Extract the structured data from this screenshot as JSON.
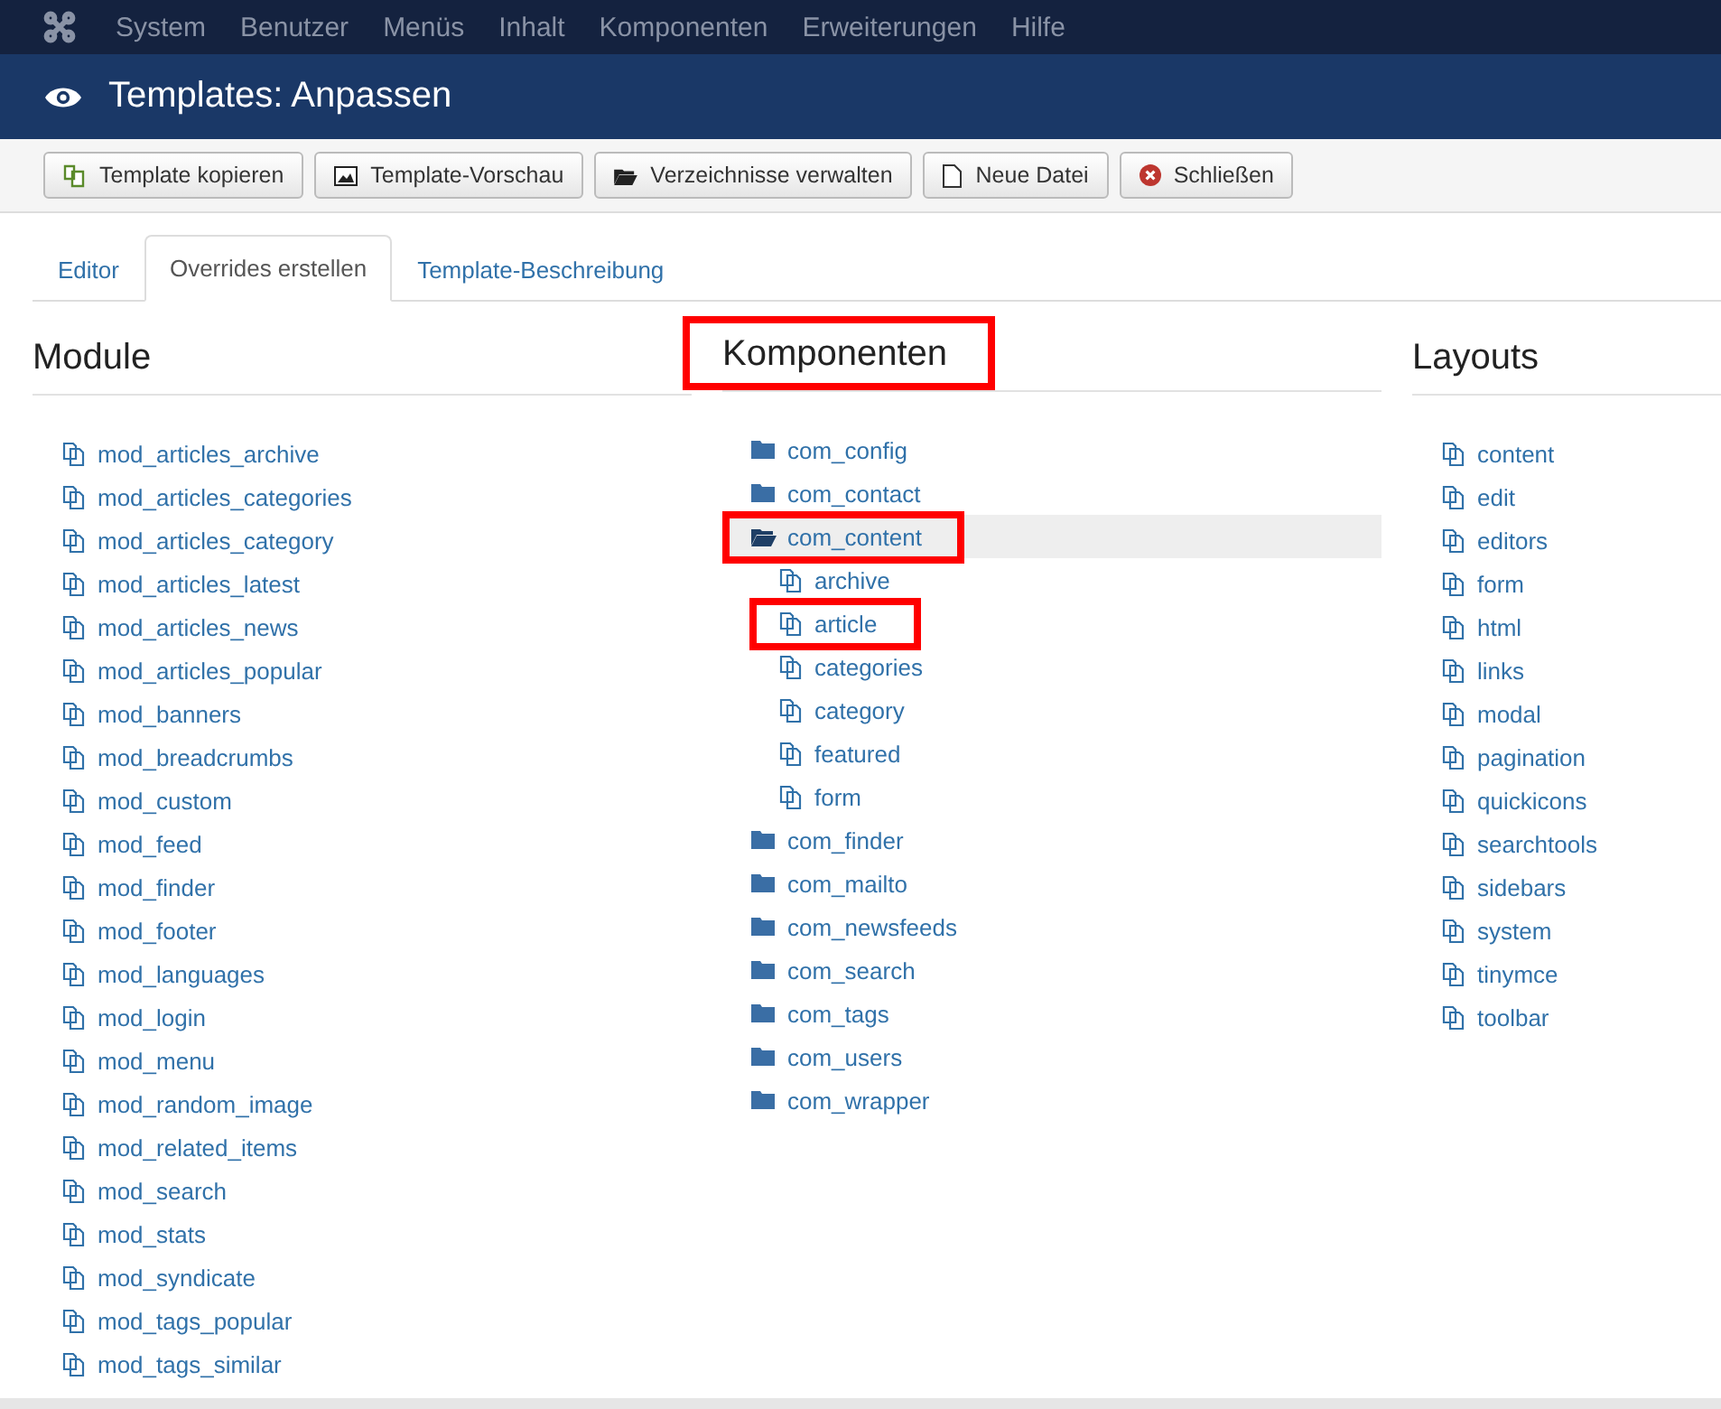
{
  "menu_bar": {
    "items": [
      "System",
      "Benutzer",
      "Menüs",
      "Inhalt",
      "Komponenten",
      "Erweiterungen",
      "Hilfe"
    ]
  },
  "header": {
    "title": "Templates: Anpassen"
  },
  "toolbar": [
    {
      "label": "Template kopieren",
      "kind": "copy"
    },
    {
      "label": "Template-Vorschau",
      "kind": "image"
    },
    {
      "label": "Verzeichnisse verwalten",
      "kind": "folder"
    },
    {
      "label": "Neue Datei",
      "kind": "file"
    },
    {
      "label": "Schließen",
      "kind": "close"
    }
  ],
  "tabs": [
    {
      "label": "Editor",
      "selected": false
    },
    {
      "label": "Overrides erstellen",
      "selected": true
    },
    {
      "label": "Template-Beschreibung",
      "selected": false
    }
  ],
  "columns": [
    {
      "heading": "Module",
      "highlighted": false,
      "items": [
        {
          "label": "mod_articles_archive",
          "kind": "file"
        },
        {
          "label": "mod_articles_categories",
          "kind": "file"
        },
        {
          "label": "mod_articles_category",
          "kind": "file"
        },
        {
          "label": "mod_articles_latest",
          "kind": "file"
        },
        {
          "label": "mod_articles_news",
          "kind": "file"
        },
        {
          "label": "mod_articles_popular",
          "kind": "file"
        },
        {
          "label": "mod_banners",
          "kind": "file"
        },
        {
          "label": "mod_breadcrumbs",
          "kind": "file"
        },
        {
          "label": "mod_custom",
          "kind": "file"
        },
        {
          "label": "mod_feed",
          "kind": "file"
        },
        {
          "label": "mod_finder",
          "kind": "file"
        },
        {
          "label": "mod_footer",
          "kind": "file"
        },
        {
          "label": "mod_languages",
          "kind": "file"
        },
        {
          "label": "mod_login",
          "kind": "file"
        },
        {
          "label": "mod_menu",
          "kind": "file"
        },
        {
          "label": "mod_random_image",
          "kind": "file"
        },
        {
          "label": "mod_related_items",
          "kind": "file"
        },
        {
          "label": "mod_search",
          "kind": "file"
        },
        {
          "label": "mod_stats",
          "kind": "file"
        },
        {
          "label": "mod_syndicate",
          "kind": "file"
        },
        {
          "label": "mod_tags_popular",
          "kind": "file"
        },
        {
          "label": "mod_tags_similar",
          "kind": "file"
        }
      ]
    },
    {
      "heading": "Komponenten",
      "highlighted": true,
      "items": [
        {
          "label": "com_config",
          "kind": "folder",
          "expanded": false,
          "selected": false,
          "highlighted": false
        },
        {
          "label": "com_contact",
          "kind": "folder",
          "expanded": false,
          "selected": false,
          "highlighted": false
        },
        {
          "label": "com_content",
          "kind": "folder",
          "expanded": true,
          "selected": true,
          "highlighted": true,
          "children": [
            {
              "label": "archive",
              "highlighted": false
            },
            {
              "label": "article",
              "highlighted": true
            },
            {
              "label": "categories",
              "highlighted": false
            },
            {
              "label": "category",
              "highlighted": false
            },
            {
              "label": "featured",
              "highlighted": false
            },
            {
              "label": "form",
              "highlighted": false
            }
          ]
        },
        {
          "label": "com_finder",
          "kind": "folder",
          "expanded": false,
          "selected": false,
          "highlighted": false
        },
        {
          "label": "com_mailto",
          "kind": "folder",
          "expanded": false,
          "selected": false,
          "highlighted": false
        },
        {
          "label": "com_newsfeeds",
          "kind": "folder",
          "expanded": false,
          "selected": false,
          "highlighted": false
        },
        {
          "label": "com_search",
          "kind": "folder",
          "expanded": false,
          "selected": false,
          "highlighted": false
        },
        {
          "label": "com_tags",
          "kind": "folder",
          "expanded": false,
          "selected": false,
          "highlighted": false
        },
        {
          "label": "com_users",
          "kind": "folder",
          "expanded": false,
          "selected": false,
          "highlighted": false
        },
        {
          "label": "com_wrapper",
          "kind": "folder",
          "expanded": false,
          "selected": false,
          "highlighted": false
        }
      ]
    },
    {
      "heading": "Layouts",
      "highlighted": false,
      "items": [
        {
          "label": "content",
          "kind": "file"
        },
        {
          "label": "edit",
          "kind": "file"
        },
        {
          "label": "editors",
          "kind": "file"
        },
        {
          "label": "form",
          "kind": "file"
        },
        {
          "label": "html",
          "kind": "file"
        },
        {
          "label": "links",
          "kind": "file"
        },
        {
          "label": "modal",
          "kind": "file"
        },
        {
          "label": "pagination",
          "kind": "file"
        },
        {
          "label": "quickicons",
          "kind": "file"
        },
        {
          "label": "searchtools",
          "kind": "file"
        },
        {
          "label": "sidebars",
          "kind": "file"
        },
        {
          "label": "system",
          "kind": "file"
        },
        {
          "label": "tinymce",
          "kind": "file"
        },
        {
          "label": "toolbar",
          "kind": "file"
        }
      ]
    }
  ]
}
